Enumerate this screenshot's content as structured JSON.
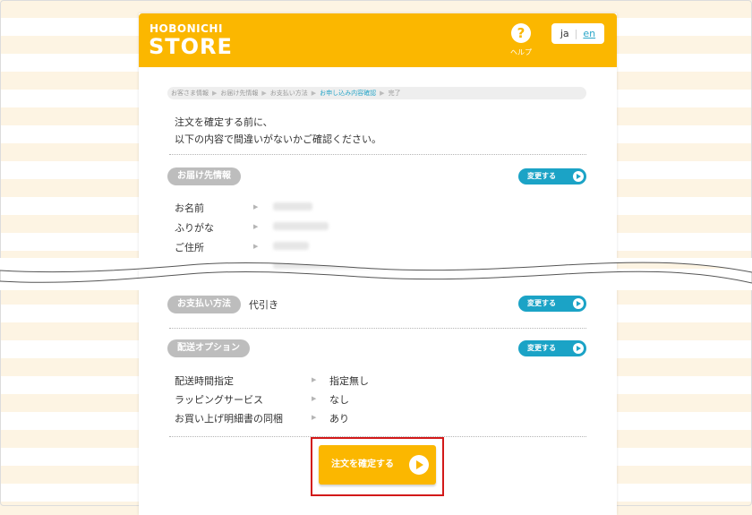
{
  "header": {
    "logo_top": "HOBONICHI",
    "logo_main": "STORE",
    "help_icon": "?",
    "help_label": "ヘルプ",
    "lang_ja": "ja",
    "lang_sep": "|",
    "lang_en": "en"
  },
  "breadcrumb": {
    "steps": [
      "お客さま情報",
      "お届け先情報",
      "お支払い方法",
      "お申し込み内容確認",
      "完了"
    ],
    "separator": "▶",
    "active_index": 3
  },
  "intro": {
    "line1": "注文を確定する前に、",
    "line2": "以下の内容で間違いがないかご確認ください。"
  },
  "delivery": {
    "title": "お届け先情報",
    "change_label": "変更する",
    "rows": [
      {
        "label": "お名前",
        "arrow": "▶"
      },
      {
        "label": "ふりがな",
        "arrow": "▶"
      },
      {
        "label": "ご住所",
        "arrow": "▶"
      }
    ]
  },
  "payment": {
    "title": "お支払い方法",
    "value": "代引き",
    "change_label": "変更する"
  },
  "shipping_options": {
    "title": "配送オプション",
    "change_label": "変更する",
    "rows": [
      {
        "label": "配送時間指定",
        "arrow": "▶",
        "value": "指定無し"
      },
      {
        "label": "ラッピングサービス",
        "arrow": "▶",
        "value": "なし"
      },
      {
        "label": "お買い上げ明細書の同梱",
        "arrow": "▶",
        "value": "あり"
      }
    ]
  },
  "confirm": {
    "label": "注文を確定する"
  },
  "colors": {
    "brand": "#fbb700",
    "accent": "#1ba3c6",
    "highlight": "#d21919",
    "pill": "#bdbdbd"
  },
  "icons": {
    "help": "question-circle-icon",
    "change_arrow": "play-circle-icon",
    "confirm_arrow": "play-circle-icon"
  }
}
